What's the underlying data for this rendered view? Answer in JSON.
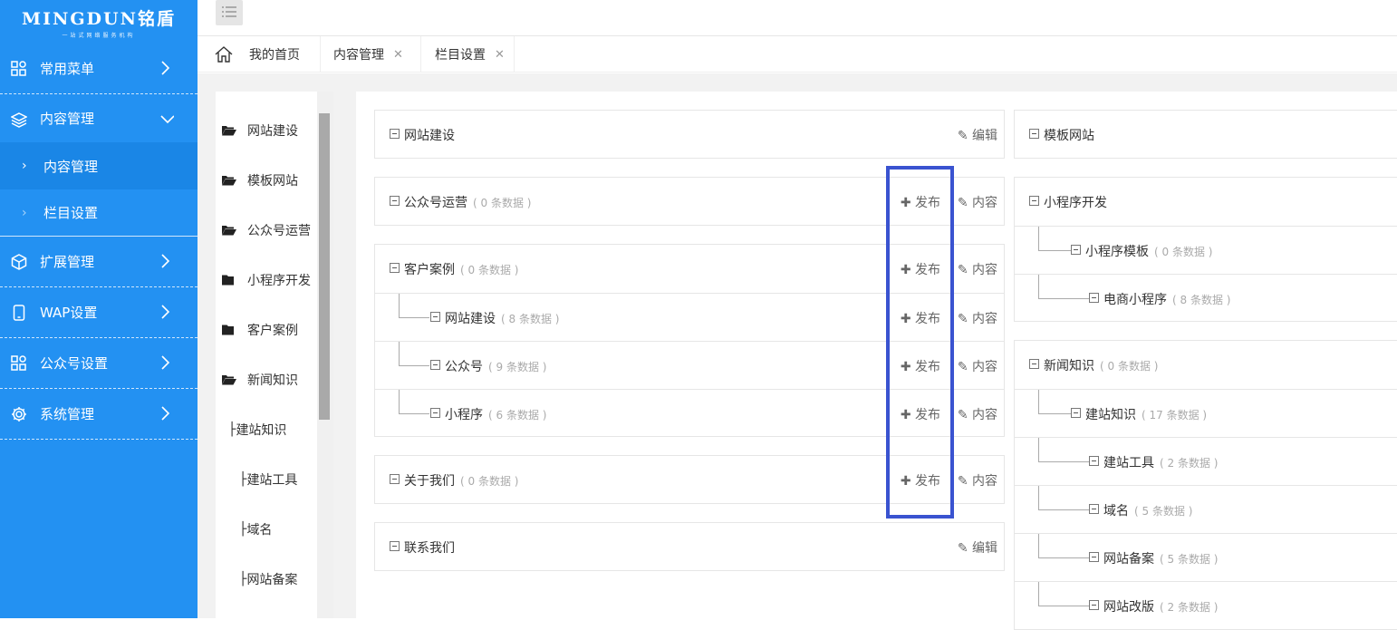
{
  "logo": {
    "brand": "MINGDUN铭盾",
    "tagline": "一站式网络服务机构"
  },
  "sidebar": {
    "menus": [
      {
        "label": "常用菜单",
        "icon": "grid-icon"
      },
      {
        "label": "内容管理",
        "icon": "layers-icon",
        "expanded": true
      },
      {
        "label": "扩展管理",
        "icon": "cube-icon"
      },
      {
        "label": "WAP设置",
        "icon": "mobile-icon"
      },
      {
        "label": "公众号设置",
        "icon": "grid-icon"
      },
      {
        "label": "系统管理",
        "icon": "gear-icon"
      }
    ],
    "submenus": [
      {
        "label": "内容管理",
        "arrow": "›"
      },
      {
        "label": "栏目设置",
        "arrow": "›"
      }
    ]
  },
  "tabs": [
    {
      "label": "我的首页"
    },
    {
      "label": "内容管理",
      "close": "✕"
    },
    {
      "label": "栏目设置",
      "close": "✕"
    }
  ],
  "tree": [
    {
      "label": "网站建设",
      "prefix": ""
    },
    {
      "label": "模板网站",
      "prefix": ""
    },
    {
      "label": "公众号运营",
      "prefix": ""
    },
    {
      "label": "小程序开发",
      "prefix": ""
    },
    {
      "label": "客户案例",
      "prefix": ""
    },
    {
      "label": "新闻知识",
      "prefix": ""
    },
    {
      "label": "建站知识",
      "prefix": "├"
    },
    {
      "label": "建站工具",
      "prefix": "├"
    },
    {
      "label": "域名",
      "prefix": "├"
    },
    {
      "label": "网站备案",
      "prefix": "├"
    }
  ],
  "actions": {
    "publish": "发布",
    "content": "内容",
    "edit": "编辑"
  },
  "left_cards": [
    {
      "rows": [
        {
          "label": "网站建设",
          "count": "",
          "action": "edit"
        }
      ]
    },
    {
      "rows": [
        {
          "label": "公众号运营",
          "count": "( 0 条数据 )",
          "action": "pub"
        }
      ]
    },
    {
      "rows": [
        {
          "label": "客户案例",
          "count": "( 0 条数据 )",
          "action": "pub"
        },
        {
          "label": "网站建设",
          "count": "( 8 条数据 )",
          "action": "pub"
        },
        {
          "label": "公众号",
          "count": "( 9 条数据 )",
          "action": "pub"
        },
        {
          "label": "小程序",
          "count": "( 6 条数据 )",
          "action": "pub"
        }
      ]
    },
    {
      "rows": [
        {
          "label": "关于我们",
          "count": "( 0 条数据 )",
          "action": "pub"
        }
      ]
    },
    {
      "rows": [
        {
          "label": "联系我们",
          "count": "",
          "action": "edit"
        }
      ]
    }
  ],
  "right_cards": [
    {
      "rows": [
        {
          "label": "模板网站",
          "count": ""
        }
      ]
    },
    {
      "rows": [
        {
          "label": "小程序开发",
          "count": ""
        },
        {
          "label": "小程序模板",
          "count": "( 0 条数据 )"
        },
        {
          "label": "电商小程序",
          "count": "( 8 条数据 )"
        }
      ]
    },
    {
      "rows": [
        {
          "label": "新闻知识",
          "count": "( 0 条数据 )"
        },
        {
          "label": "建站知识",
          "count": "( 17 条数据 )"
        },
        {
          "label": "建站工具",
          "count": "( 2 条数据 )"
        },
        {
          "label": "域名",
          "count": "( 5 条数据 )"
        },
        {
          "label": "网站备案",
          "count": "( 5 条数据 )"
        },
        {
          "label": "网站改版",
          "count": "( 2 条数据 )"
        }
      ]
    }
  ],
  "colors": {
    "sidebar": "#2391f2",
    "highlight": "#3a53d0"
  }
}
